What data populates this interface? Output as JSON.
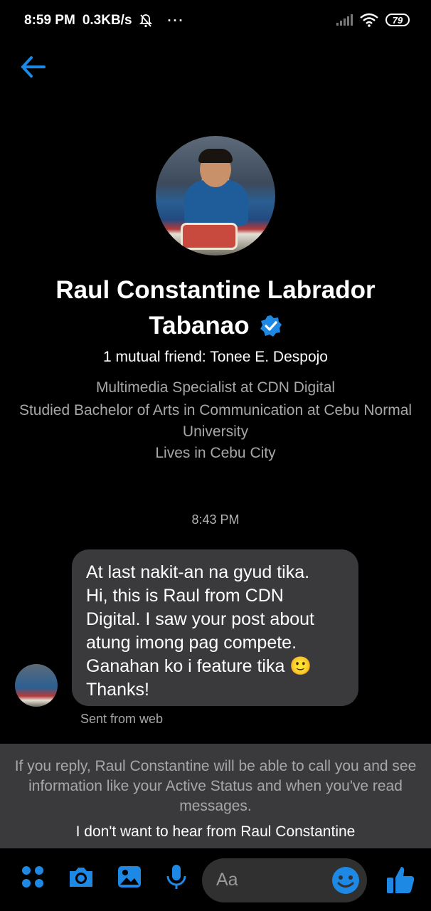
{
  "status": {
    "time": "8:59 PM",
    "speed": "0.3KB/s",
    "more": "···",
    "battery": "79"
  },
  "profile": {
    "name_line1": "Raul Constantine Labrador",
    "name_line2": "Tabanao",
    "mutual": "1 mutual friend: Tonee E. Despojo",
    "work": "Multimedia Specialist at CDN Digital",
    "study": "Studied Bachelor of Arts in Communication at Cebu Normal University",
    "lives": "Lives in Cebu City"
  },
  "conversation": {
    "timestamp": "8:43 PM",
    "message": {
      "lines": [
        "At last nakit-an na gyud tika.",
        "Hi, this is Raul from CDN",
        "Digital. I saw your post about",
        "atung imong pag compete.",
        "Ganahan ko i feature tika 🙂",
        "Thanks!"
      ],
      "meta": "Sent from web"
    }
  },
  "notice": {
    "text": "If you reply, Raul Constantine will be able to call you and see information like your Active Status and when you've read messages.",
    "action": "I don't want to hear from Raul Constantine"
  },
  "composer": {
    "placeholder": "Aa",
    "icons": [
      "menu-dots-icon",
      "camera-icon",
      "gallery-icon",
      "microphone-icon",
      "emoji-icon",
      "like-icon"
    ],
    "accent": "#1e88e5"
  }
}
